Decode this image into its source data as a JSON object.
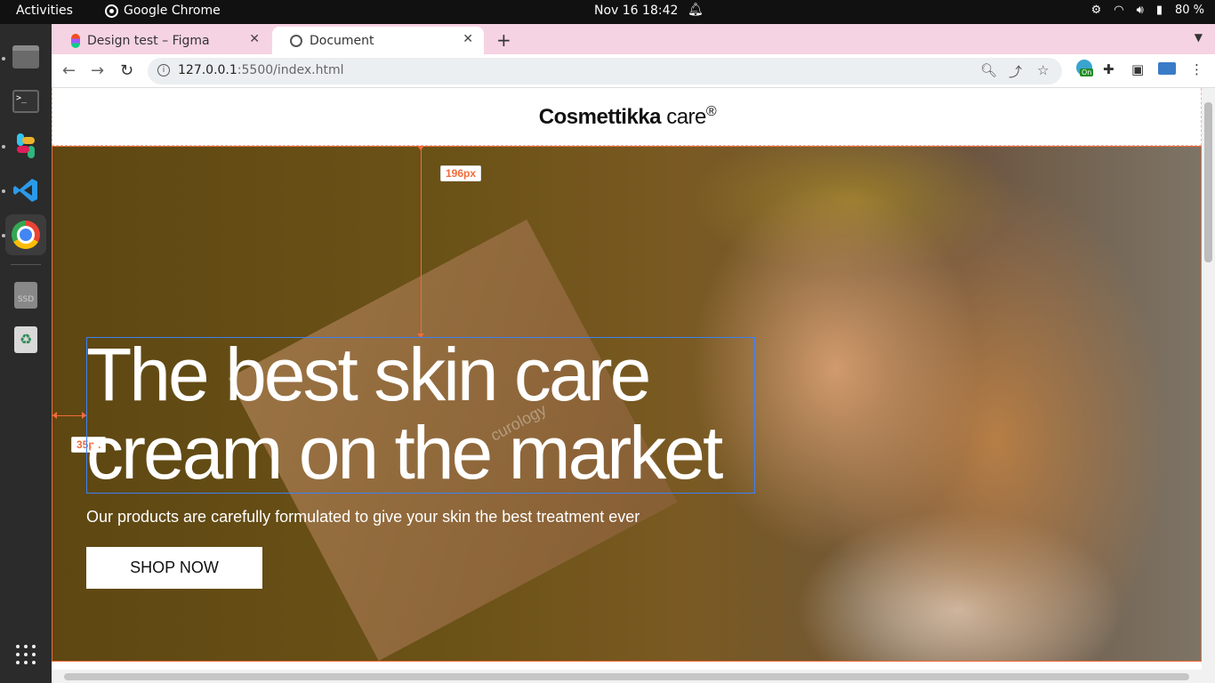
{
  "system": {
    "activities": "Activities",
    "app_name": "Google Chrome",
    "clock": "Nov 16  18:42",
    "battery": "80 %"
  },
  "browser": {
    "tabs": [
      {
        "title": "Design test – Figma",
        "icon": "figma-icon",
        "active": false
      },
      {
        "title": "Document",
        "icon": "globe-icon",
        "active": true
      }
    ],
    "url_host": "127.0.0.1",
    "url_path": ":5500/index.html",
    "extension_badge": "On"
  },
  "page": {
    "logo_bold": "Cosmettikka",
    "logo_light": " care",
    "logo_mark": "®",
    "headline": "The best skin care cream on the market",
    "subtitle": "Our products are carefully formulated to give your skin the best treatment ever",
    "cta": "SHOP NOW",
    "box_brand": "curology"
  },
  "measurements": {
    "top_gap": "196px",
    "left_gap": "35px"
  },
  "colors": {
    "tabstrip": "#f6d3e3",
    "measure": "#f26b3a",
    "selection": "#3b82f6"
  }
}
